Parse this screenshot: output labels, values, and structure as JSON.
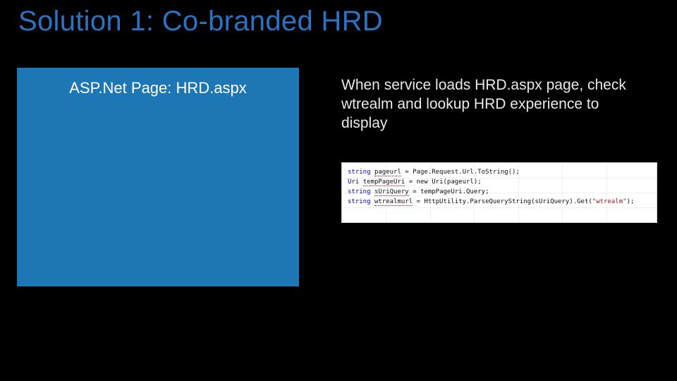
{
  "title": "Solution 1: Co-branded HRD",
  "blueBox": {
    "label": "ASP.Net Page:  HRD.aspx"
  },
  "description": "When service loads HRD.aspx page, check wtrealm and lookup HRD experience to display",
  "code": {
    "lines": [
      {
        "kw": "string",
        "id": "pageurl",
        "rest": " = Page.Request.Url.ToString();"
      },
      {
        "kw": "Uri",
        "id": "tempPageUri",
        "rest": " = new Uri(pageurl);"
      },
      {
        "kw": "string",
        "id": "sUriQuery",
        "rest": " = tempPageUri.Query;"
      },
      {
        "kw": "string",
        "id": "wtrealmurl",
        "rest": " = HttpUtility.ParseQueryString(sUriQuery).Get(",
        "str": "\"wtrealm\"",
        "tail": ");"
      }
    ]
  }
}
